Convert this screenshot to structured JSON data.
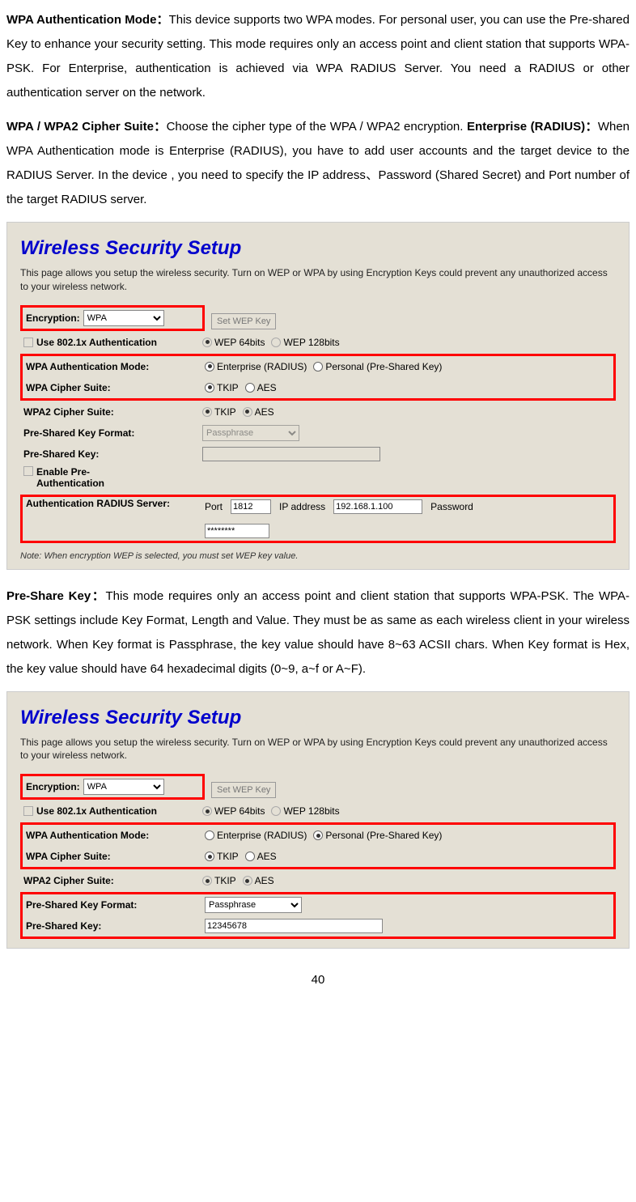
{
  "para1": {
    "t1": "WPA Authentication Mode：",
    "p1": "This device supports two WPA modes. For personal user, you can use the Pre-shared Key to enhance your security setting. This mode requires only an access point and client station that supports WPA-PSK. For Enterprise, authentication is achieved via WPA RADIUS Server. You need a RADIUS or other authentication server on the network."
  },
  "para2": {
    "t1": "WPA / WPA2 Cipher Suite：",
    "p1": "Choose the cipher type of the WPA / WPA2 encryption.",
    "t2": "Enterprise (RADIUS)：",
    "p2": "When WPA Authentication mode is Enterprise (RADIUS), you have to add user accounts and the target device to the RADIUS Server. In the device , you need to specify the IP address、Password (Shared Secret) and Port number of the target RADIUS server."
  },
  "app1": {
    "title": "Wireless Security Setup",
    "desc": "This page allows you setup the wireless security. Turn on WEP or WPA by using Encryption Keys could prevent any unauthorized access to your wireless network.",
    "enc_label": "Encryption:",
    "enc_value": "WPA",
    "setwep": "Set WEP Key",
    "use8021x": "Use 802.1x Authentication",
    "wep64": "WEP 64bits",
    "wep128": "WEP 128bits",
    "wpa_auth_label": "WPA Authentication Mode:",
    "enterprise": "Enterprise (RADIUS)",
    "personal": "Personal (Pre-Shared Key)",
    "wpa_cipher_label": "WPA Cipher Suite:",
    "wpa2_cipher_label": "WPA2 Cipher Suite:",
    "tkip": "TKIP",
    "aes": "AES",
    "psk_format_label": "Pre-Shared Key Format:",
    "psk_format_value": "Passphrase",
    "psk_label": "Pre-Shared Key:",
    "enable_preauth": "Enable Pre-Authentication",
    "radius_label": "Authentication RADIUS Server:",
    "port_label": "Port",
    "port_value": "1812",
    "ip_label": "IP address",
    "ip_value": "192.168.1.100",
    "pwd_label": "Password",
    "pwd_value": "********",
    "note": "Note: When encryption WEP is selected, you must set WEP key value."
  },
  "para3": {
    "t1": "Pre-Share Key：",
    "p1": "This mode requires only an access point and client station that supports WPA-PSK. The WPA-PSK settings include Key Format, Length and Value. They must be as same as each wireless client in your wireless network. When Key format is Passphrase, the key value should have 8~63 ACSII chars. When Key format is Hex, the key value should have 64 hexadecimal digits (0~9, a~f or A~F)."
  },
  "app2": {
    "psk_value": "12345678"
  },
  "page": "40"
}
